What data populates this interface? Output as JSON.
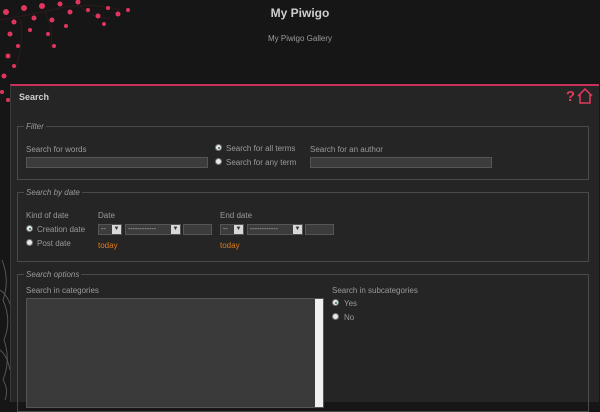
{
  "header": {
    "title": "My Piwigo",
    "subtitle": "My Piwigo Gallery"
  },
  "page": {
    "title": "Search",
    "help_label": "?"
  },
  "filter": {
    "legend": "Filter",
    "words_label": "Search for words",
    "words_value": "",
    "all_terms_label": "Search for all terms",
    "any_term_label": "Search for any term",
    "author_label": "Search for an author",
    "author_value": ""
  },
  "date": {
    "legend": "Search by date",
    "kind_label": "Kind of date",
    "creation_label": "Creation date",
    "post_label": "Post date",
    "start_label": "Date",
    "end_label": "End date",
    "day_placeholder": "--",
    "month_placeholder": "------------",
    "today_label": "today"
  },
  "options": {
    "legend": "Search options",
    "categories_label": "Search in categories",
    "subcats_label": "Search in subcategories",
    "yes_label": "Yes",
    "no_label": "No"
  },
  "colors": {
    "accent": "#c8325a",
    "today": "#e07b1a",
    "background": "#161616",
    "panel": "#252525"
  }
}
